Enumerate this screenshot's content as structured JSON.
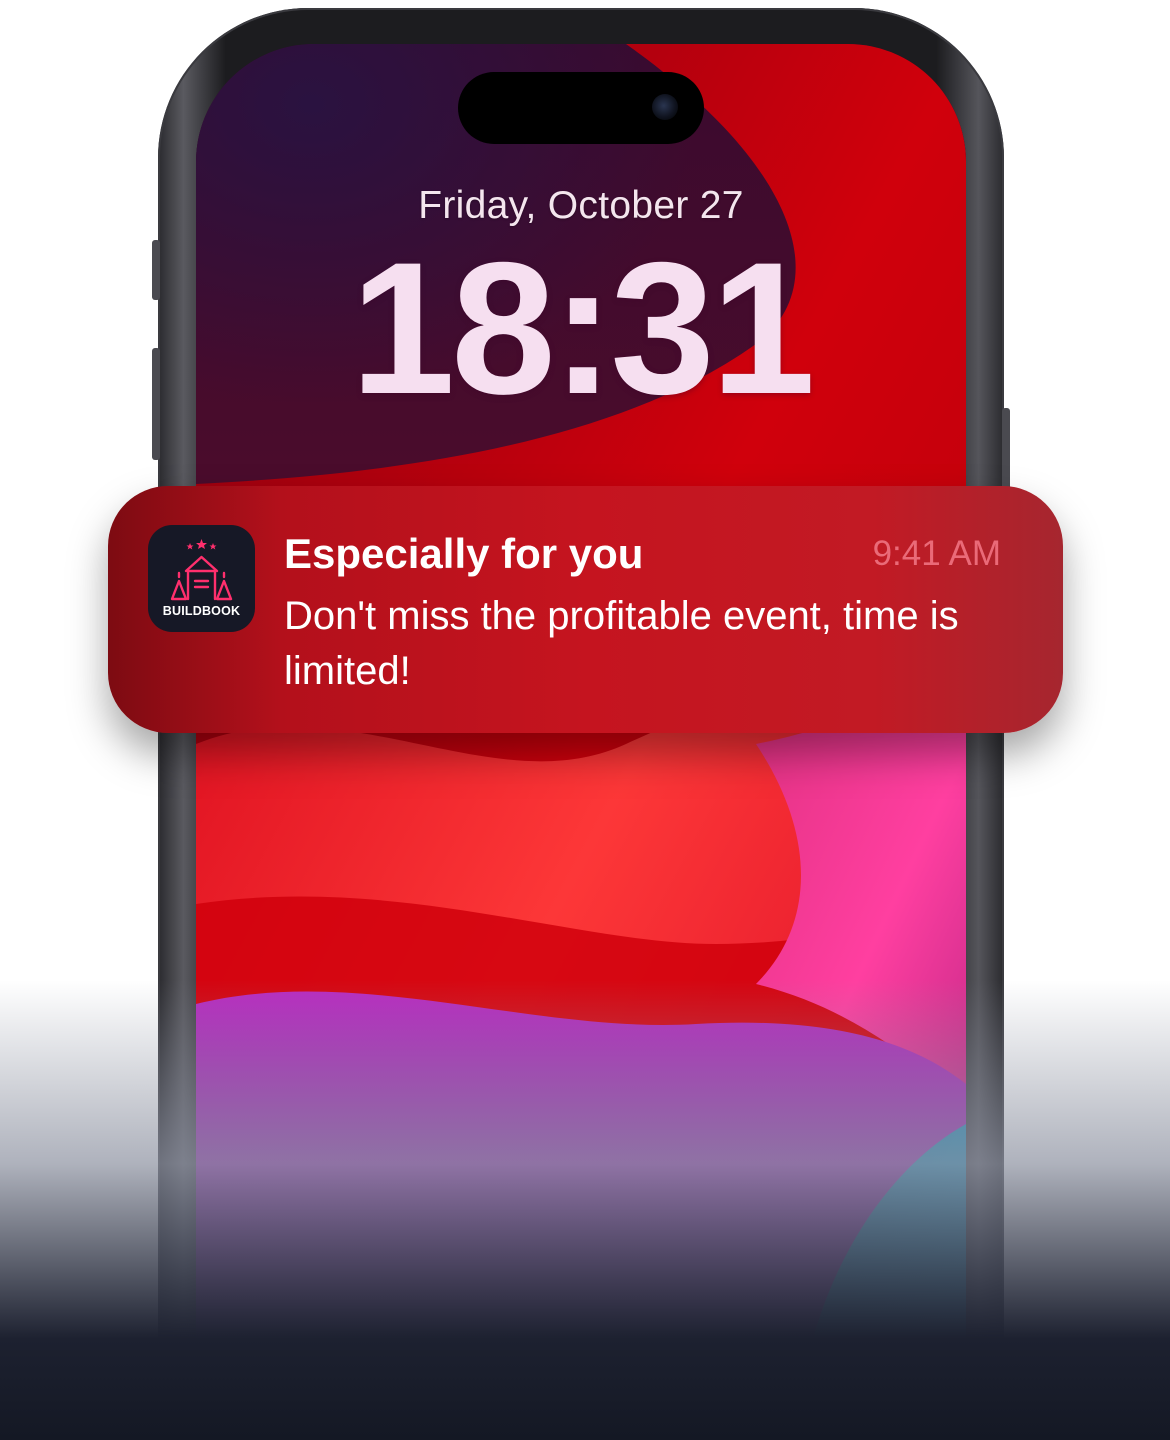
{
  "lock_screen": {
    "date": "Friday, October 27",
    "time": "18:31"
  },
  "notification": {
    "app_name": "BUILDBOOK",
    "app_icon": "castle-icon",
    "title": "Especially for you",
    "time": "9:41 AM",
    "body": "Don't miss the profitable event, time is limited!"
  },
  "colors": {
    "notification_bg": "#c5141f",
    "time_text": "#ea6a78",
    "icon_bg": "#161826",
    "icon_accent": "#ff2f6d"
  }
}
